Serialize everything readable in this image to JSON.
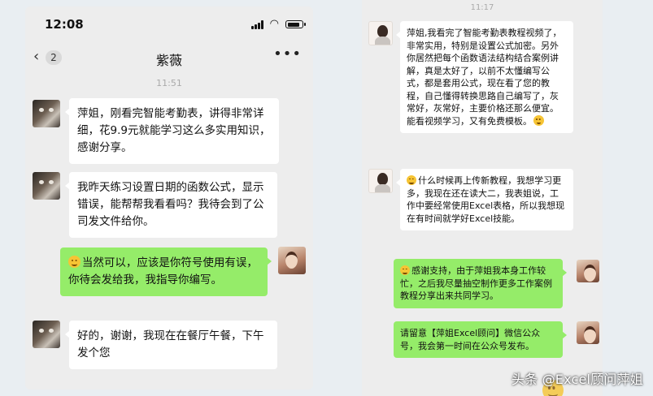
{
  "left": {
    "status_time": "12:08",
    "nav": {
      "badge": "2",
      "title": "紫薇"
    },
    "timestamp": "11:51",
    "messages": [
      {
        "from": "other",
        "text": "萍姐，刚看完智能考勤表，讲得非常详细，花9.9元就能学习这么多实用知识，感谢分享。"
      },
      {
        "from": "other",
        "text": "我昨天练习设置日期的函数公式，显示错误，能帮帮我看看吗？我待会到了公司发文件给你。"
      },
      {
        "from": "me",
        "text": "当然可以，应该是你符号使用有误，你待会发给我，我指导你编写。"
      },
      {
        "from": "other",
        "text": "好的，谢谢，我现在在餐厅午餐，下午发个您"
      }
    ]
  },
  "right": {
    "timestamp": "11:17",
    "messages": [
      {
        "from": "other",
        "text": "萍姐,我看完了智能考勤表教程视频了，非常实用，特别是设置公式加密。另外你居然把每个函数语法结构结合案例讲解，真是太好了，以前不太懂编写公式，都是套用公式，现在看了您的教程，自己懂得转换思路自己编写了，灰常好，灰常好，主要价格还那么便宜。能看视频学习，又有免费模板。"
      },
      {
        "from": "other",
        "text": "什么时候再上传新教程，我想学习更多，我现在还在读大二，我表姐说，工作中要经常使用Excel表格，所以我想现在有时间就学好Excel技能。"
      },
      {
        "from": "me",
        "text": "感谢支持，由于萍姐我本身工作较忙，之后我尽量抽空制作更多工作案例教程分享出来共同学习。"
      },
      {
        "from": "me",
        "text": "请留意【萍姐Excel顾问】微信公众号，我会第一时间在公众号发布。"
      }
    ]
  },
  "watermark": "头条 @Excel顾问萍姐",
  "icons": {
    "back": "chevron-left-icon",
    "more": "more-dots-icon",
    "signal": "signal-icon",
    "wifi": "wifi-icon",
    "battery": "battery-icon",
    "emoji": "smile-emoji-icon"
  },
  "colors": {
    "chat_bg": "#ededed",
    "bubble_in": "#ffffff",
    "bubble_out": "#95ec69",
    "timestamp": "#aaaaaa"
  }
}
